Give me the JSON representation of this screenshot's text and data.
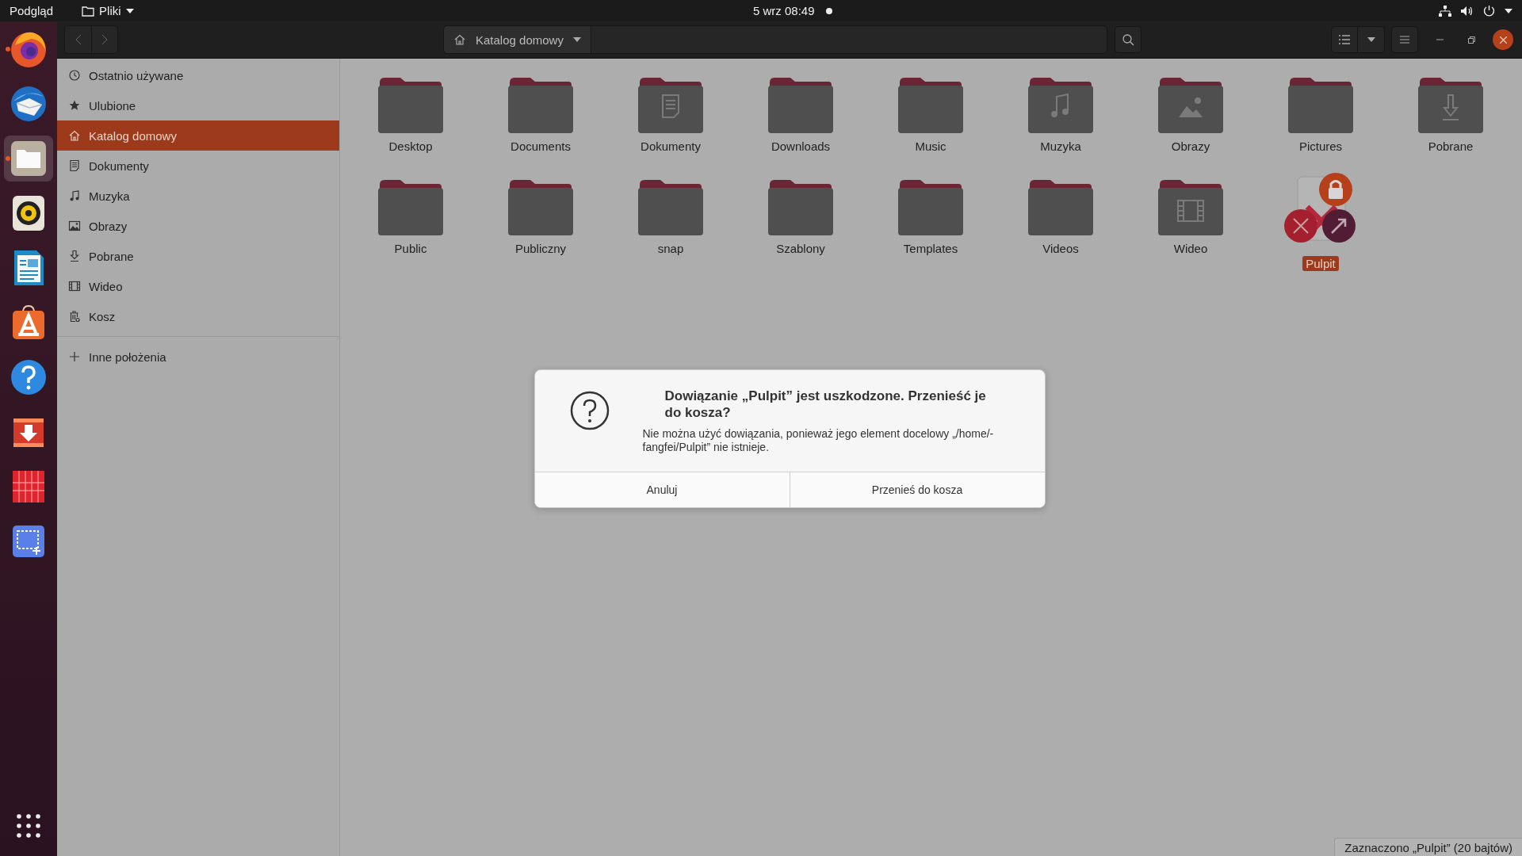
{
  "top_bar": {
    "activities": "Podgląd",
    "app_menu": "Pliki",
    "clock": "5 wrz  08:49",
    "notification": true
  },
  "dock": {
    "items": [
      {
        "kind": "firefox",
        "running": true,
        "selected": false
      },
      {
        "kind": "thunderbird",
        "running": false,
        "selected": false
      },
      {
        "kind": "files",
        "running": true,
        "selected": true
      },
      {
        "kind": "rhythmbox",
        "running": false,
        "selected": false
      },
      {
        "kind": "writer",
        "running": false,
        "selected": false
      },
      {
        "kind": "software",
        "running": false,
        "selected": false
      },
      {
        "kind": "help",
        "running": false,
        "selected": false
      },
      {
        "kind": "downloader",
        "running": false,
        "selected": false
      },
      {
        "kind": "redgrid",
        "running": false,
        "selected": false
      },
      {
        "kind": "screenshot",
        "running": false,
        "selected": false
      }
    ]
  },
  "header": {
    "path": "Katalog domowy"
  },
  "sidebar": {
    "items": [
      {
        "kind": "recent",
        "label": "Ostatnio używane",
        "selected": false
      },
      {
        "kind": "starred",
        "label": "Ulubione",
        "selected": false
      },
      {
        "kind": "home",
        "label": "Katalog domowy",
        "selected": true
      },
      {
        "kind": "documents",
        "label": "Dokumenty",
        "selected": false
      },
      {
        "kind": "music",
        "label": "Muzyka",
        "selected": false
      },
      {
        "kind": "pictures",
        "label": "Obrazy",
        "selected": false
      },
      {
        "kind": "downloads",
        "label": "Pobrane",
        "selected": false
      },
      {
        "kind": "videos",
        "label": "Wideo",
        "selected": false
      },
      {
        "kind": "trash",
        "label": "Kosz",
        "selected": false
      }
    ],
    "other_locations": "Inne położenia"
  },
  "files": [
    {
      "name": "Desktop",
      "kind": "folder",
      "selected": false
    },
    {
      "name": "Documents",
      "kind": "folder",
      "selected": false
    },
    {
      "name": "Dokumenty",
      "kind": "documents",
      "selected": false
    },
    {
      "name": "Downloads",
      "kind": "folder",
      "selected": false
    },
    {
      "name": "Music",
      "kind": "folder",
      "selected": false
    },
    {
      "name": "Muzyka",
      "kind": "music",
      "selected": false
    },
    {
      "name": "Obrazy",
      "kind": "pictures",
      "selected": false
    },
    {
      "name": "Pictures",
      "kind": "folder",
      "selected": false
    },
    {
      "name": "Pobrane",
      "kind": "downloads",
      "selected": false
    },
    {
      "name": "Public",
      "kind": "folder",
      "selected": false
    },
    {
      "name": "Publiczny",
      "kind": "folder",
      "selected": false
    },
    {
      "name": "snap",
      "kind": "folder",
      "selected": false
    },
    {
      "name": "Szablony",
      "kind": "folder",
      "selected": false
    },
    {
      "name": "Templates",
      "kind": "folder",
      "selected": false
    },
    {
      "name": "Videos",
      "kind": "folder",
      "selected": false
    },
    {
      "name": "Wideo",
      "kind": "videos",
      "selected": false
    },
    {
      "name": "Pulpit",
      "kind": "broken_link",
      "selected": true
    }
  ],
  "dialog": {
    "title": "Dowiązanie „Pulpit” jest uszkodzone. Przenieść je do kosza?",
    "message": "Nie można użyć dowiązania, ponieważ jego element docelowy „/home/-fangfei/Pulpit” nie istnieje.",
    "buttons": [
      "Anuluj",
      "Przenieś do kosza"
    ]
  },
  "status_bar": "Zaznaczono „Pulpit” (20 bajtów)"
}
